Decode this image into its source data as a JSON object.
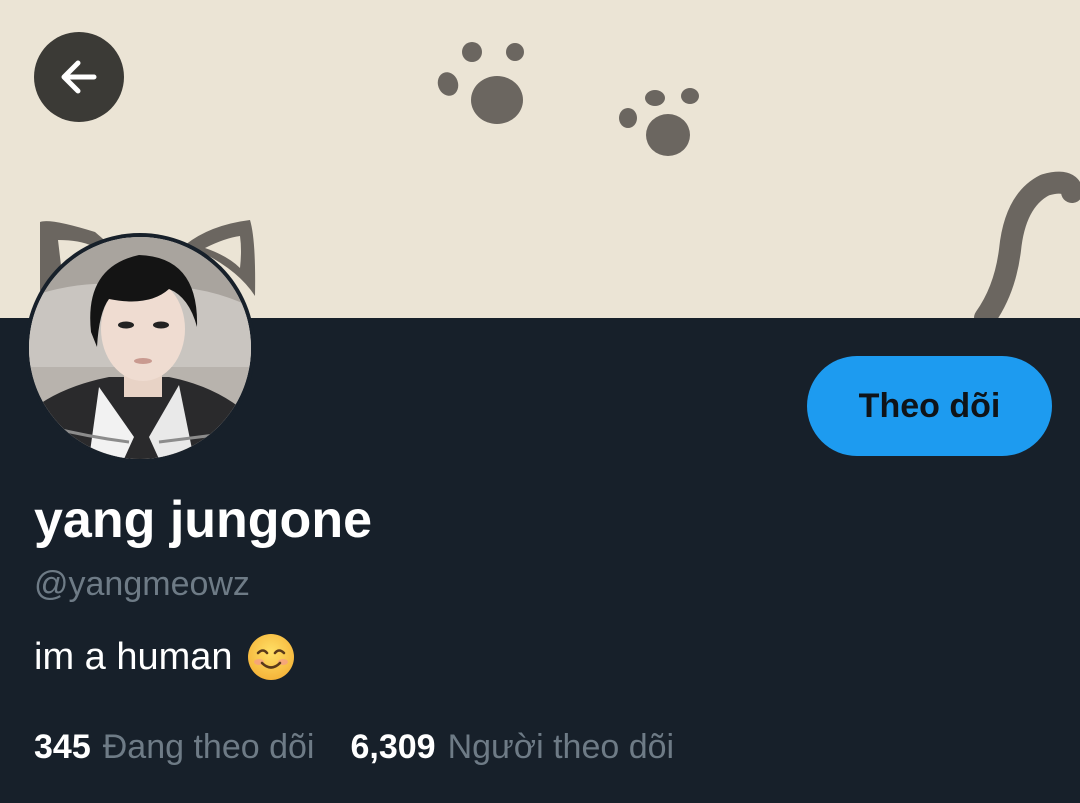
{
  "header": {
    "back_icon": "arrow-left-icon"
  },
  "profile": {
    "display_name": "yang jungone",
    "handle": "@yangmeowz",
    "bio": "im a human",
    "bio_emoji": "smiling-face-icon",
    "follow_label": "Theo dõi"
  },
  "stats": {
    "following_count": "345",
    "following_label": "Đang theo dõi",
    "followers_count": "6,309",
    "followers_label": "Người theo dõi"
  },
  "colors": {
    "background": "#17202a",
    "banner": "#ebe4d5",
    "accent": "#1d9bf0",
    "secondary_text": "#6e7b86"
  }
}
